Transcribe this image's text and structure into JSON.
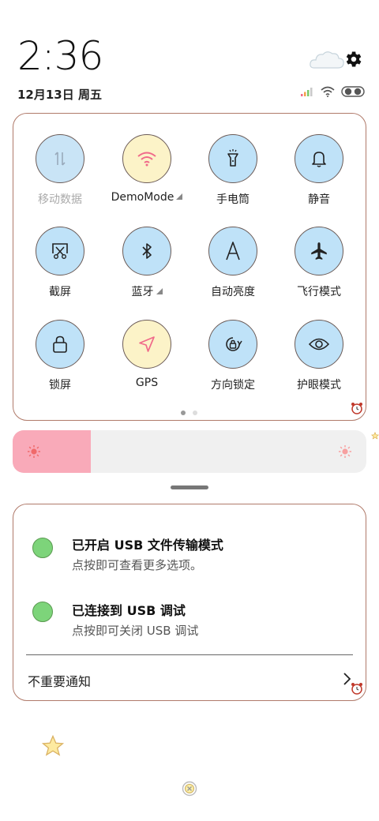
{
  "status": {
    "time": "2:36",
    "date": "12月13日 周五"
  },
  "quick_settings": {
    "tiles": [
      {
        "label": "移动数据",
        "icon": "mobile-data-icon",
        "state": "disabled",
        "dropdown": false
      },
      {
        "label": "DemoMode",
        "icon": "wifi-icon",
        "state": "on",
        "dropdown": true
      },
      {
        "label": "手电筒",
        "icon": "flashlight-icon",
        "state": "off",
        "dropdown": false
      },
      {
        "label": "静音",
        "icon": "bell-icon",
        "state": "off",
        "dropdown": false
      },
      {
        "label": "截屏",
        "icon": "screenshot-icon",
        "state": "off",
        "dropdown": false
      },
      {
        "label": "蓝牙",
        "icon": "bluetooth-icon",
        "state": "off",
        "dropdown": true
      },
      {
        "label": "自动亮度",
        "icon": "auto-brightness-icon",
        "state": "off",
        "dropdown": false
      },
      {
        "label": "飞行模式",
        "icon": "airplane-icon",
        "state": "off",
        "dropdown": false
      },
      {
        "label": "锁屏",
        "icon": "lock-icon",
        "state": "off",
        "dropdown": false
      },
      {
        "label": "GPS",
        "icon": "location-icon",
        "state": "on",
        "dropdown": false
      },
      {
        "label": "方向锁定",
        "icon": "rotation-lock-icon",
        "state": "off",
        "dropdown": false
      },
      {
        "label": "护眼模式",
        "icon": "eye-icon",
        "state": "off",
        "dropdown": false
      }
    ],
    "page_count": 2,
    "current_page": 1
  },
  "brightness": {
    "level": 0.22,
    "color": "#f9aab9"
  },
  "notifications": [
    {
      "title": "已开启 USB 文件传输模式",
      "subtitle": "点按即可查看更多选项。"
    },
    {
      "title": "已连接到 USB 调试",
      "subtitle": "点按即可关闭 USB 调试"
    }
  ],
  "unimportant_label": "不重要通知",
  "colors": {
    "tile_blue": "#bfe2f8",
    "tile_cream": "#fcf3c8",
    "accent_pink": "#f06a8a",
    "panel_border": "#b07a6a"
  }
}
